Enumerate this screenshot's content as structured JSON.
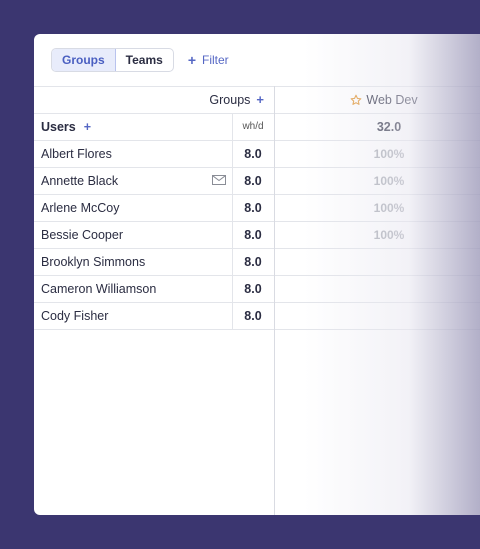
{
  "toolbar": {
    "tab_groups": "Groups",
    "tab_teams": "Teams",
    "filter_label": "Filter"
  },
  "table": {
    "groups_header": "Groups",
    "group_column": "Web Dev",
    "users_header": "Users",
    "hours_header": "wh/d",
    "group_total": "32.0",
    "rows": [
      {
        "name": "Albert Flores",
        "hours": "8.0",
        "pct": "100%"
      },
      {
        "name": "Annette Black",
        "hours": "8.0",
        "pct": "100%"
      },
      {
        "name": "Arlene McCoy",
        "hours": "8.0",
        "pct": "100%"
      },
      {
        "name": "Bessie Cooper",
        "hours": "8.0",
        "pct": "100%"
      },
      {
        "name": "Brooklyn Simmons",
        "hours": "8.0",
        "pct": ""
      },
      {
        "name": "Cameron Williamson",
        "hours": "8.0",
        "pct": ""
      },
      {
        "name": "Cody Fisher",
        "hours": "8.0",
        "pct": ""
      }
    ]
  },
  "colors": {
    "background": "#3b3670",
    "accent": "#5567c4",
    "star": "#e39a3b"
  }
}
